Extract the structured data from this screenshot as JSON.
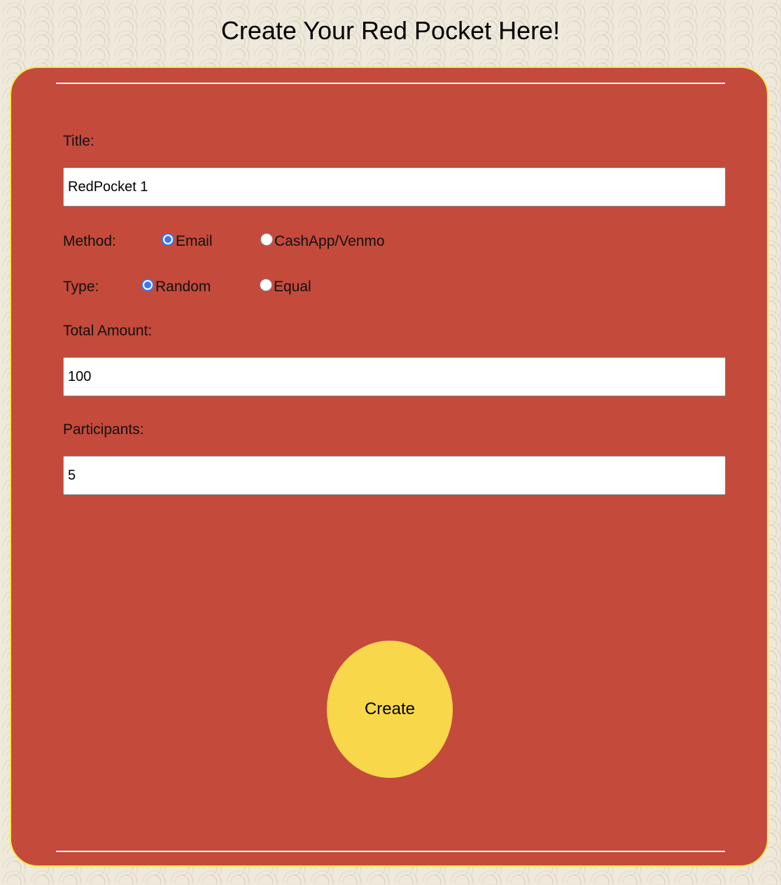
{
  "page": {
    "title": "Create Your Red Pocket Here!"
  },
  "form": {
    "title_label": "Title:",
    "title_value": "RedPocket 1",
    "method_label": "Method:",
    "method_options": [
      {
        "label": "Email",
        "checked": true
      },
      {
        "label": "CashApp/Venmo",
        "checked": false
      }
    ],
    "type_label": "Type:",
    "type_options": [
      {
        "label": "Random",
        "checked": true
      },
      {
        "label": "Equal",
        "checked": false
      }
    ],
    "amount_label": "Total Amount:",
    "amount_value": "100",
    "participants_label": "Participants:",
    "participants_value": "5",
    "create_label": "Create"
  },
  "colors": {
    "card_background": "#c44a3b",
    "card_border": "#f2ea4a",
    "button_background": "#f8d74a",
    "radio_accent": "#3b78f0"
  }
}
